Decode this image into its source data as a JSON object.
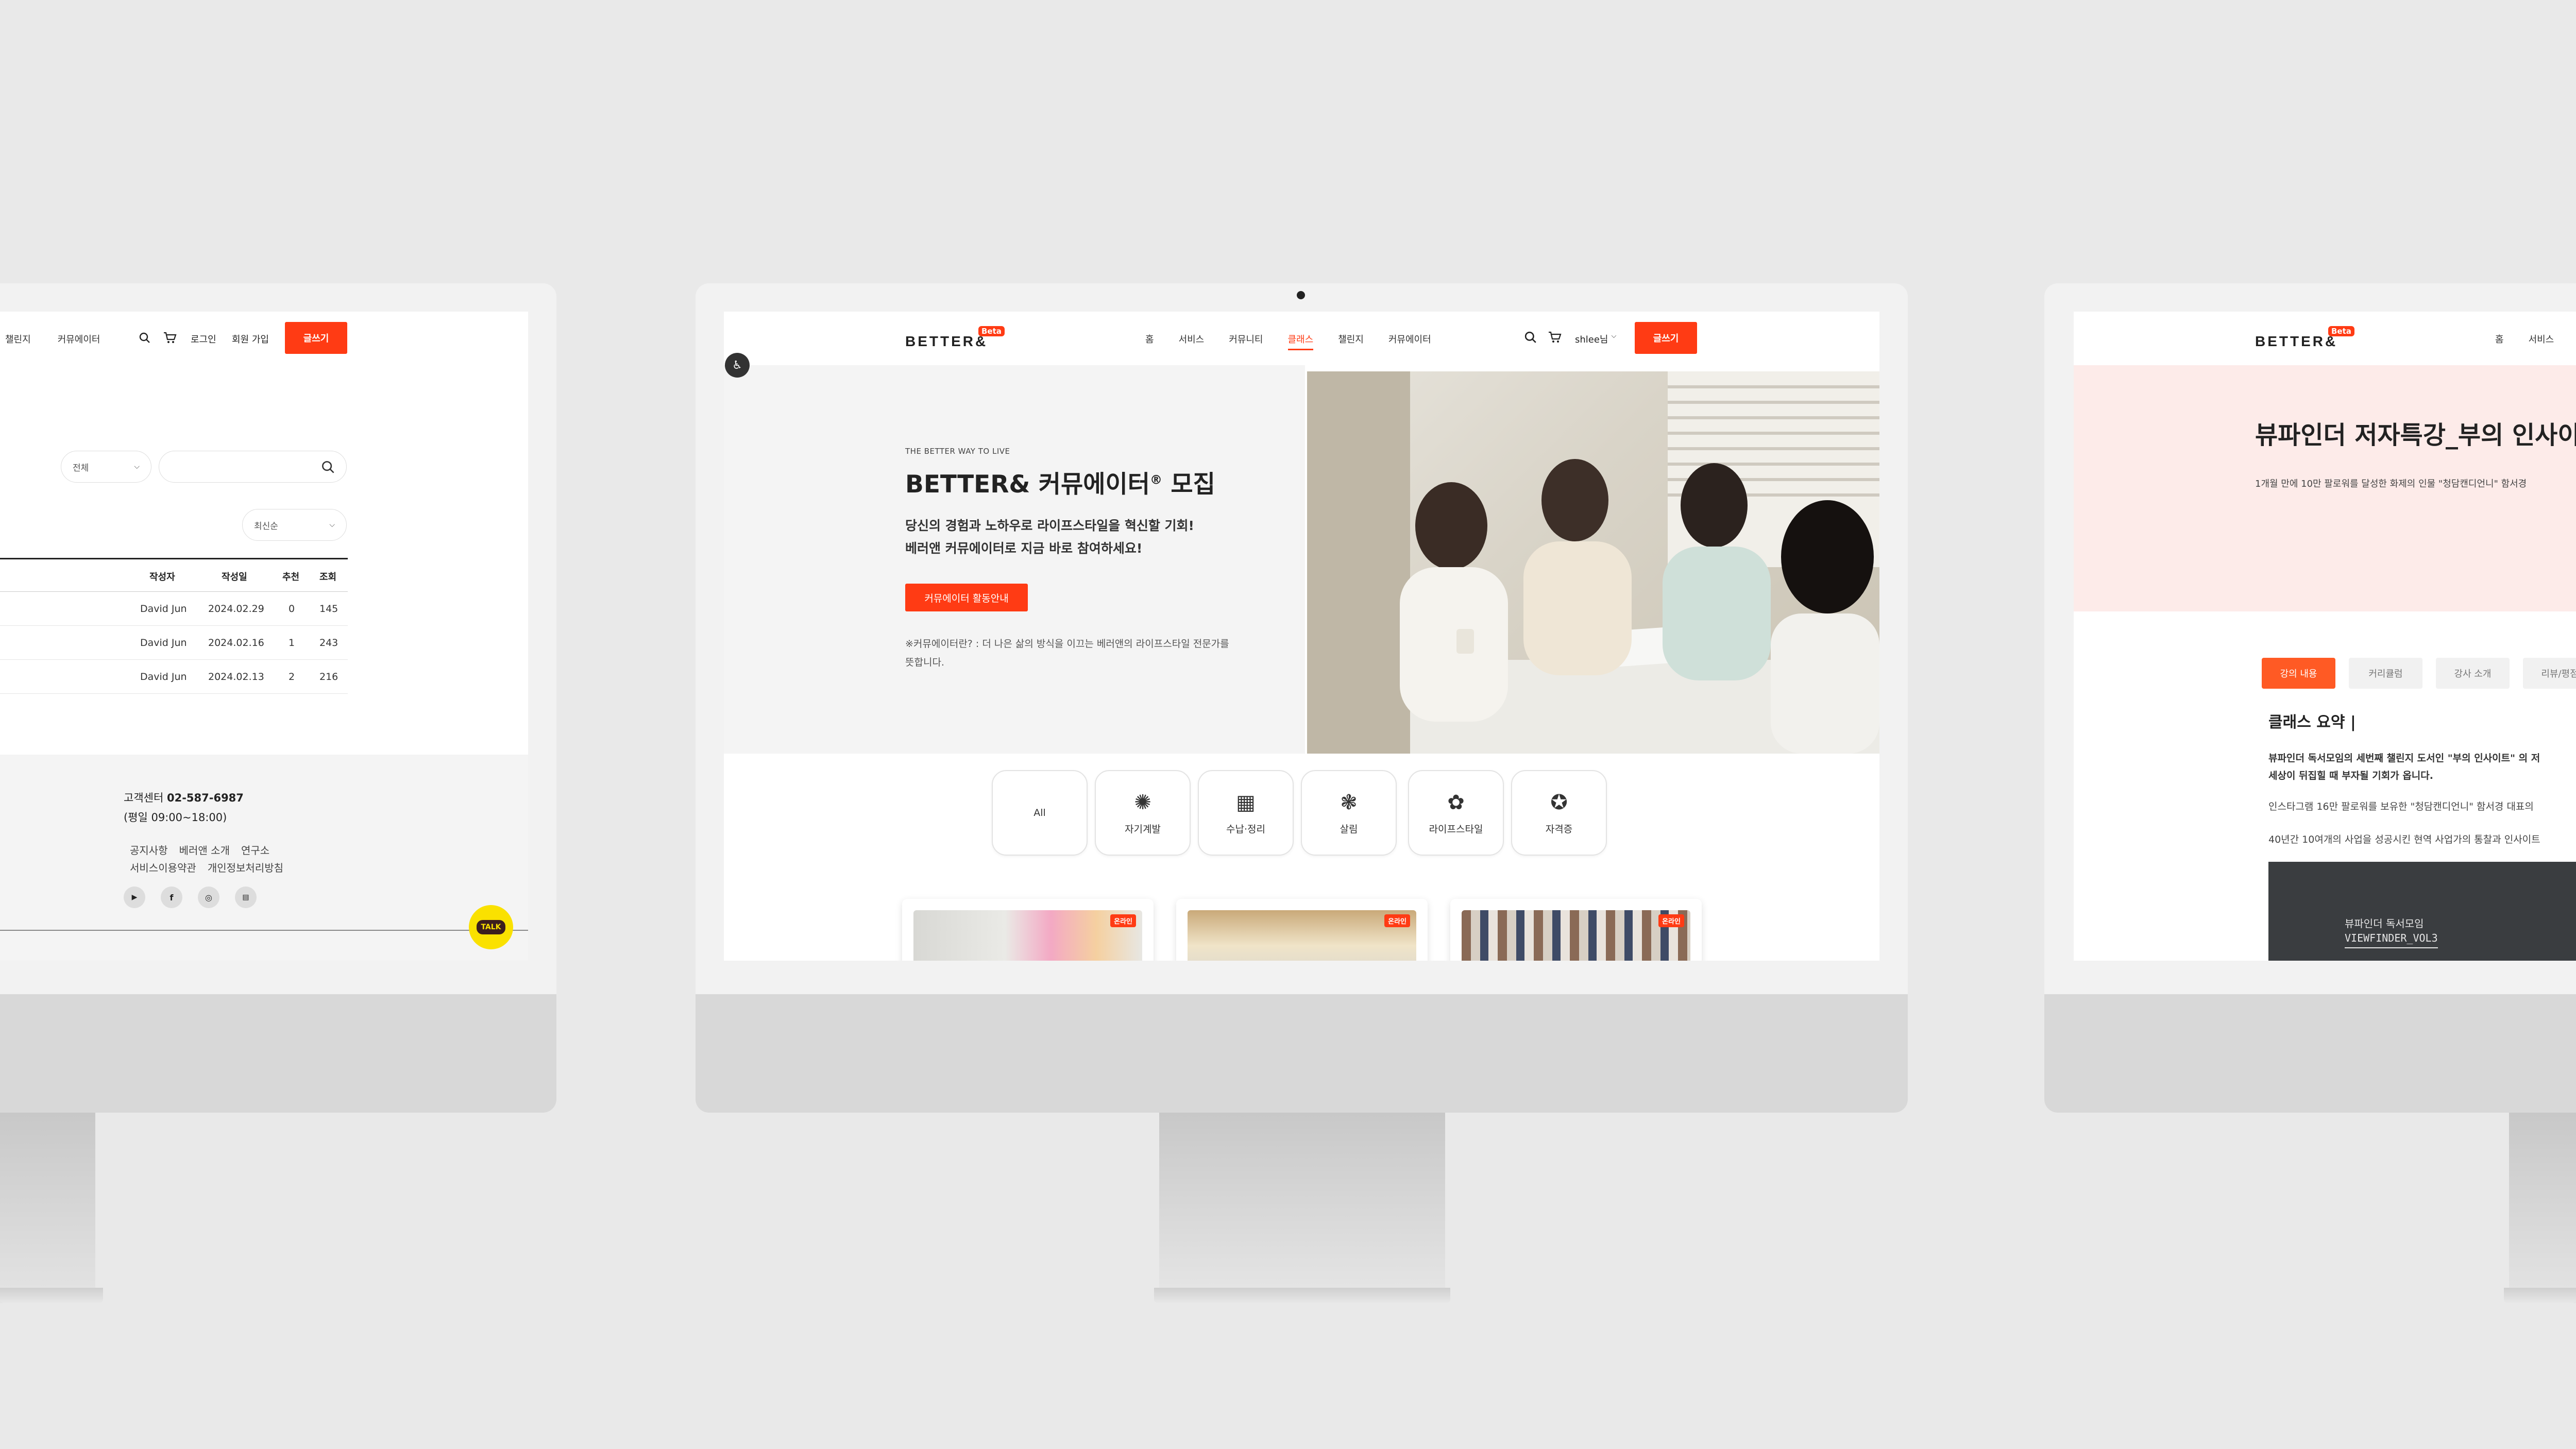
{
  "left_screen": {
    "nav": [
      "챌린지",
      "커뮤에이터"
    ],
    "login": "로그인",
    "signup": "회원 가입",
    "write_button": "글쓰기",
    "filter_select": "전체",
    "sort_select": "최신순",
    "table_headers": [
      "작성자",
      "작성일",
      "추천",
      "조회"
    ],
    "rows": [
      {
        "author": "David Jun",
        "date": "2024.02.29",
        "likes": "0",
        "views": "145"
      },
      {
        "author": "David Jun",
        "date": "2024.02.16",
        "likes": "1",
        "views": "243"
      },
      {
        "author": "David Jun",
        "date": "2024.02.13",
        "likes": "2",
        "views": "216"
      }
    ],
    "footer": {
      "cs_label": "고객센터",
      "cs_phone": "02-587-6987",
      "hours": "(평일 09:00~18:00)",
      "links_row1": [
        "공지사항",
        "베러앤 소개",
        "연구소"
      ],
      "links_row2": [
        "서비스이용약관",
        "개인정보처리방침"
      ]
    },
    "talk_label": "TALK"
  },
  "center_screen": {
    "logo": "BETTER&",
    "beta": "Beta",
    "nav": [
      "홈",
      "서비스",
      "커뮤니티",
      "클래스",
      "챌린지",
      "커뮤에이터"
    ],
    "nav_active": "클래스",
    "user": "shlee님",
    "write_button": "글쓰기",
    "hero": {
      "eyebrow": "THE BETTER WAY TO LIVE",
      "title_prefix": "BETTER& 커뮤에이터",
      "title_reg": "®",
      "title_suffix": "모집",
      "subtitle_line1": "당신의 경험과 노하우로 라이프스타일을 혁신할 기회!",
      "subtitle_line2": "베러앤 커뮤에이터로 지금 바로 참여하세요!",
      "cta": "커뮤에이터 활동안내",
      "note_line1": "※커뮤에이터란? : 더 나은 삶의 방식을 이끄는 베러앤의 라이프스타일 전문가를",
      "note_line2": "뜻합니다."
    },
    "categories": [
      {
        "label": "All",
        "icon": ""
      },
      {
        "label": "자기계발",
        "icon": "self-development-icon"
      },
      {
        "label": "수납·정리",
        "icon": "storage-icon"
      },
      {
        "label": "살림",
        "icon": "housekeeping-icon"
      },
      {
        "label": "라이프스타일",
        "icon": "lifestyle-icon"
      },
      {
        "label": "자격증",
        "icon": "certificate-icon"
      }
    ],
    "card_tag": "온라인"
  },
  "right_screen": {
    "logo": "BETTER&",
    "beta": "Beta",
    "nav": [
      "홈",
      "서비스"
    ],
    "title": "뷰파인더 저자특강_부의 인사이",
    "subtitle": "1개월 만에 10만 팔로워를 달성한 화제의 인물 \"청담캔디언니\" 함서경",
    "tabs": [
      "강의 내용",
      "커리큘럼",
      "강사 소개",
      "리뷰/평점"
    ],
    "section_title": "클래스 요약 |",
    "para1_line1": "뷰파인더 독서모임의 세번째 챌린지 도서인 \"부의 인사이트\" 의 저",
    "para1_line2": "세상이 뒤집힐 때 부자될 기회가 옵니다.",
    "para2": "인스타그램 16만 팔로워를 보유한 \"청담캔디언니\" 함서경 대표의",
    "para3": "40년간 10여개의 사업을 성공시킨 현역 사업가의 통찰과 인사이트",
    "banner_line1": "뷰파인더 독서모임",
    "banner_line2": "VIEWFINDER_VOL3"
  },
  "colors": {
    "accent": "#ff3b14",
    "background": "#e9e9e9"
  }
}
